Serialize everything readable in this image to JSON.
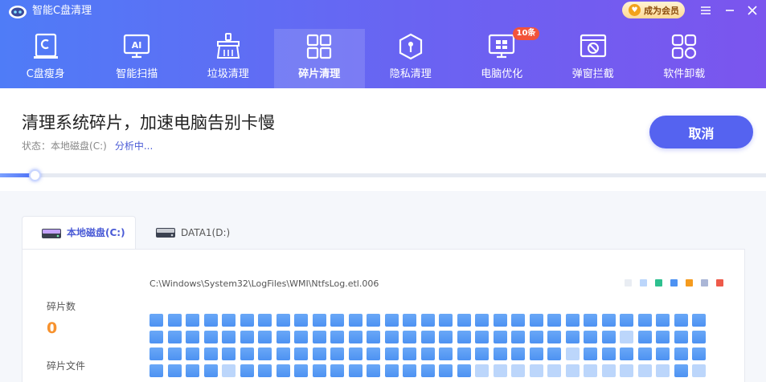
{
  "app": {
    "title": "智能C盘清理"
  },
  "vip": {
    "label": "成为会员"
  },
  "colors": {
    "accent": "#5563f0",
    "orange": "#f7922e",
    "block_blue": "#4d92f2",
    "block_light": "#bcd6fb",
    "block_empty": "#e5ecf7"
  },
  "nav": {
    "items": [
      {
        "label": "C盘瘦身",
        "icon": "c-drive-icon"
      },
      {
        "label": "智能扫描",
        "icon": "ai-scan-icon"
      },
      {
        "label": "垃圾清理",
        "icon": "broom-icon"
      },
      {
        "label": "碎片清理",
        "icon": "fragment-grid-icon",
        "active": true
      },
      {
        "label": "隐私清理",
        "icon": "privacy-shield-icon"
      },
      {
        "label": "电脑优化",
        "icon": "windows-monitor-icon",
        "badge": "10条"
      },
      {
        "label": "弹窗拦截",
        "icon": "popup-block-icon"
      },
      {
        "label": "软件卸载",
        "icon": "apps-uninstall-icon"
      }
    ]
  },
  "status": {
    "headline": "清理系统碎片，加速电脑告别卡慢",
    "label": "状态：",
    "disk": "本地磁盘(C:)",
    "progress_text": "分析中...",
    "progress_fraction": 0.045
  },
  "cancel_label": "取消",
  "tabs": [
    {
      "label": "本地磁盘(C:)",
      "active": true
    },
    {
      "label": "DATA1(D:)",
      "active": false
    }
  ],
  "stats": {
    "fragments_label": "碎片数",
    "fragments_value": "0",
    "fragment_files_label": "碎片文件"
  },
  "current_file": "C:\\Windows\\System32\\LogFiles\\WMI\\NtfsLog.etl.006",
  "legend_colors": [
    "#e9edf3",
    "#bcd6fb",
    "#2ec08f",
    "#4d92f2",
    "#f59b1e",
    "#aab6d6",
    "#ee5a4a"
  ],
  "block_map": [
    "BBBBBBBBBBBBBBBBBBBBBBBBBBBBBBB",
    "BBBBBBBBBBBBBBBBBBBBBBBBBBLBBBB",
    "BBBBBBBBBBBBBBBBBBBBBBBLBBBBBBB",
    "BBBBLBBBBBBBBBBBBBLLLLLLLLLLLBL"
  ]
}
